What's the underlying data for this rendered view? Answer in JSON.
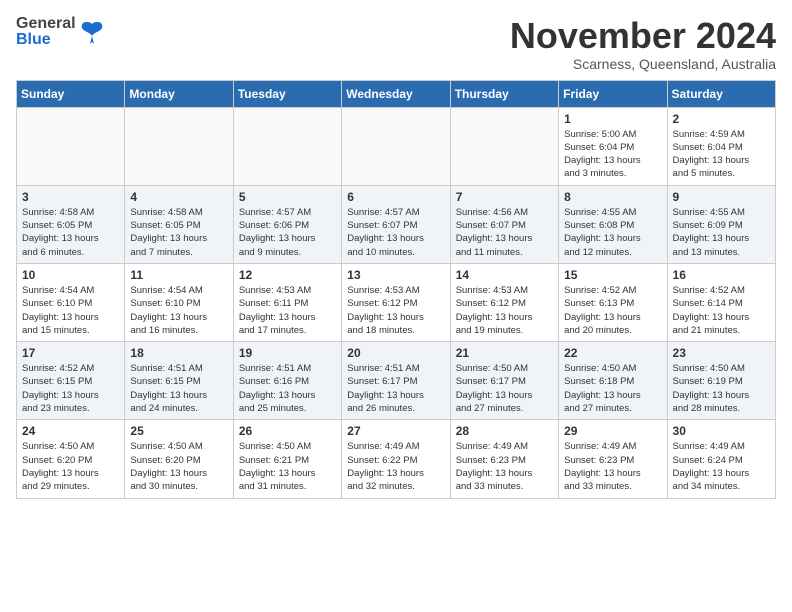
{
  "header": {
    "logo": {
      "general": "General",
      "blue": "Blue",
      "alt": "GeneralBlue Logo"
    },
    "title": "November 2024",
    "location": "Scarness, Queensland, Australia"
  },
  "weekdays": [
    "Sunday",
    "Monday",
    "Tuesday",
    "Wednesday",
    "Thursday",
    "Friday",
    "Saturday"
  ],
  "weeks": [
    [
      {
        "day": "",
        "info": ""
      },
      {
        "day": "",
        "info": ""
      },
      {
        "day": "",
        "info": ""
      },
      {
        "day": "",
        "info": ""
      },
      {
        "day": "",
        "info": ""
      },
      {
        "day": "1",
        "info": "Sunrise: 5:00 AM\nSunset: 6:04 PM\nDaylight: 13 hours\nand 3 minutes."
      },
      {
        "day": "2",
        "info": "Sunrise: 4:59 AM\nSunset: 6:04 PM\nDaylight: 13 hours\nand 5 minutes."
      }
    ],
    [
      {
        "day": "3",
        "info": "Sunrise: 4:58 AM\nSunset: 6:05 PM\nDaylight: 13 hours\nand 6 minutes."
      },
      {
        "day": "4",
        "info": "Sunrise: 4:58 AM\nSunset: 6:05 PM\nDaylight: 13 hours\nand 7 minutes."
      },
      {
        "day": "5",
        "info": "Sunrise: 4:57 AM\nSunset: 6:06 PM\nDaylight: 13 hours\nand 9 minutes."
      },
      {
        "day": "6",
        "info": "Sunrise: 4:57 AM\nSunset: 6:07 PM\nDaylight: 13 hours\nand 10 minutes."
      },
      {
        "day": "7",
        "info": "Sunrise: 4:56 AM\nSunset: 6:07 PM\nDaylight: 13 hours\nand 11 minutes."
      },
      {
        "day": "8",
        "info": "Sunrise: 4:55 AM\nSunset: 6:08 PM\nDaylight: 13 hours\nand 12 minutes."
      },
      {
        "day": "9",
        "info": "Sunrise: 4:55 AM\nSunset: 6:09 PM\nDaylight: 13 hours\nand 13 minutes."
      }
    ],
    [
      {
        "day": "10",
        "info": "Sunrise: 4:54 AM\nSunset: 6:10 PM\nDaylight: 13 hours\nand 15 minutes."
      },
      {
        "day": "11",
        "info": "Sunrise: 4:54 AM\nSunset: 6:10 PM\nDaylight: 13 hours\nand 16 minutes."
      },
      {
        "day": "12",
        "info": "Sunrise: 4:53 AM\nSunset: 6:11 PM\nDaylight: 13 hours\nand 17 minutes."
      },
      {
        "day": "13",
        "info": "Sunrise: 4:53 AM\nSunset: 6:12 PM\nDaylight: 13 hours\nand 18 minutes."
      },
      {
        "day": "14",
        "info": "Sunrise: 4:53 AM\nSunset: 6:12 PM\nDaylight: 13 hours\nand 19 minutes."
      },
      {
        "day": "15",
        "info": "Sunrise: 4:52 AM\nSunset: 6:13 PM\nDaylight: 13 hours\nand 20 minutes."
      },
      {
        "day": "16",
        "info": "Sunrise: 4:52 AM\nSunset: 6:14 PM\nDaylight: 13 hours\nand 21 minutes."
      }
    ],
    [
      {
        "day": "17",
        "info": "Sunrise: 4:52 AM\nSunset: 6:15 PM\nDaylight: 13 hours\nand 23 minutes."
      },
      {
        "day": "18",
        "info": "Sunrise: 4:51 AM\nSunset: 6:15 PM\nDaylight: 13 hours\nand 24 minutes."
      },
      {
        "day": "19",
        "info": "Sunrise: 4:51 AM\nSunset: 6:16 PM\nDaylight: 13 hours\nand 25 minutes."
      },
      {
        "day": "20",
        "info": "Sunrise: 4:51 AM\nSunset: 6:17 PM\nDaylight: 13 hours\nand 26 minutes."
      },
      {
        "day": "21",
        "info": "Sunrise: 4:50 AM\nSunset: 6:17 PM\nDaylight: 13 hours\nand 27 minutes."
      },
      {
        "day": "22",
        "info": "Sunrise: 4:50 AM\nSunset: 6:18 PM\nDaylight: 13 hours\nand 27 minutes."
      },
      {
        "day": "23",
        "info": "Sunrise: 4:50 AM\nSunset: 6:19 PM\nDaylight: 13 hours\nand 28 minutes."
      }
    ],
    [
      {
        "day": "24",
        "info": "Sunrise: 4:50 AM\nSunset: 6:20 PM\nDaylight: 13 hours\nand 29 minutes."
      },
      {
        "day": "25",
        "info": "Sunrise: 4:50 AM\nSunset: 6:20 PM\nDaylight: 13 hours\nand 30 minutes."
      },
      {
        "day": "26",
        "info": "Sunrise: 4:50 AM\nSunset: 6:21 PM\nDaylight: 13 hours\nand 31 minutes."
      },
      {
        "day": "27",
        "info": "Sunrise: 4:49 AM\nSunset: 6:22 PM\nDaylight: 13 hours\nand 32 minutes."
      },
      {
        "day": "28",
        "info": "Sunrise: 4:49 AM\nSunset: 6:23 PM\nDaylight: 13 hours\nand 33 minutes."
      },
      {
        "day": "29",
        "info": "Sunrise: 4:49 AM\nSunset: 6:23 PM\nDaylight: 13 hours\nand 33 minutes."
      },
      {
        "day": "30",
        "info": "Sunrise: 4:49 AM\nSunset: 6:24 PM\nDaylight: 13 hours\nand 34 minutes."
      }
    ]
  ]
}
